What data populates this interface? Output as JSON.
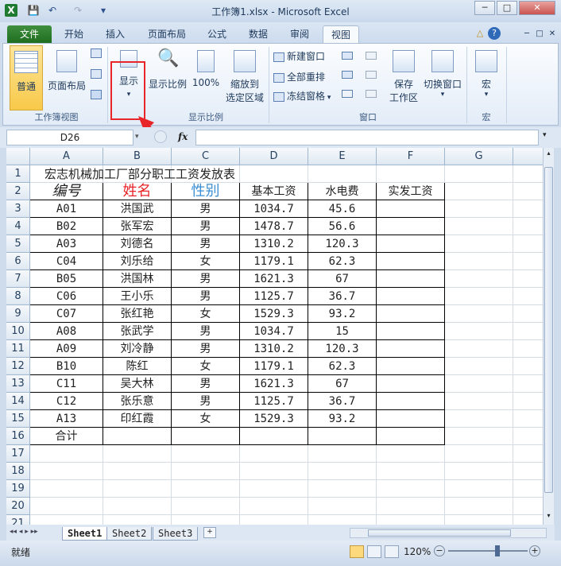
{
  "window": {
    "title": "工作簿1.xlsx - Microsoft Excel",
    "minimize": "─",
    "maximize": "□",
    "close": "✕",
    "inner_min": "─",
    "inner_max": "□",
    "inner_close": "✕"
  },
  "quick_access": [
    "excel-logo-icon",
    "save-icon",
    "undo-icon",
    "redo-icon",
    "customize-qat-icon"
  ],
  "tabs": [
    {
      "label": "文件"
    },
    {
      "label": "开始"
    },
    {
      "label": "插入"
    },
    {
      "label": "页面布局"
    },
    {
      "label": "公式"
    },
    {
      "label": "数据"
    },
    {
      "label": "审阅"
    },
    {
      "label": "视图"
    }
  ],
  "ribbon": {
    "workbook_views": {
      "normal": "普通",
      "page_layout": "页面布局",
      "group": "工作簿视图"
    },
    "show": {
      "label": "显示"
    },
    "zoom": {
      "zoom": "显示比例",
      "hundred": "100%",
      "to_selection_1": "缩放到",
      "to_selection_2": "选定区域",
      "group": "显示比例"
    },
    "window": {
      "new_window": "新建窗口",
      "arrange_all": "全部重排",
      "freeze": "冻结窗格",
      "save_workspace_1": "保存",
      "save_workspace_2": "工作区",
      "switch": "切换窗口",
      "group": "窗口"
    },
    "macros": {
      "label": "宏",
      "group": "宏"
    }
  },
  "formula_bar": {
    "name_box": "D26",
    "fx": "fx",
    "value": ""
  },
  "columns": [
    "A",
    "B",
    "C",
    "D",
    "E",
    "F",
    "G"
  ],
  "rows": [
    "1",
    "2",
    "3",
    "4",
    "5",
    "6",
    "7",
    "8",
    "9",
    "10",
    "11",
    "12",
    "13",
    "14",
    "15",
    "16",
    "17",
    "18",
    "19",
    "20",
    "21"
  ],
  "sheet": {
    "title": "宏志机械加工厂部分职工工资发放表",
    "headers": [
      "编号",
      "姓名",
      "性别",
      "基本工资",
      "水电费",
      "实发工资"
    ],
    "data": [
      [
        "A01",
        "洪国武",
        "男",
        "1034.7",
        "45.6",
        ""
      ],
      [
        "B02",
        "张军宏",
        "男",
        "1478.7",
        "56.6",
        ""
      ],
      [
        "A03",
        "刘德名",
        "男",
        "1310.2",
        "120.3",
        ""
      ],
      [
        "C04",
        "刘乐给",
        "女",
        "1179.1",
        "62.3",
        ""
      ],
      [
        "B05",
        "洪国林",
        "男",
        "1621.3",
        "67",
        ""
      ],
      [
        "C06",
        "王小乐",
        "男",
        "1125.7",
        "36.7",
        ""
      ],
      [
        "C07",
        "张红艳",
        "女",
        "1529.3",
        "93.2",
        ""
      ],
      [
        "A08",
        "张武学",
        "男",
        "1034.7",
        "15",
        ""
      ],
      [
        "A09",
        "刘冷静",
        "男",
        "1310.2",
        "120.3",
        ""
      ],
      [
        "B10",
        "陈红",
        "女",
        "1179.1",
        "62.3",
        ""
      ],
      [
        "C11",
        "吴大林",
        "男",
        "1621.3",
        "67",
        ""
      ],
      [
        "C12",
        "张乐意",
        "男",
        "1125.7",
        "36.7",
        ""
      ],
      [
        "A13",
        "印红霞",
        "女",
        "1529.3",
        "93.2",
        ""
      ]
    ],
    "total_label": "合计"
  },
  "sheet_tabs": [
    "Sheet1",
    "Sheet2",
    "Sheet3"
  ],
  "status": {
    "ready": "就绪",
    "zoom": "120%",
    "minus": "−",
    "plus": "+"
  },
  "colors": {
    "header_name": "#e8262a",
    "header_gender": "#3b8fd2",
    "highlight_box": "#e8262a",
    "file_tab": "#2a7d2a"
  }
}
